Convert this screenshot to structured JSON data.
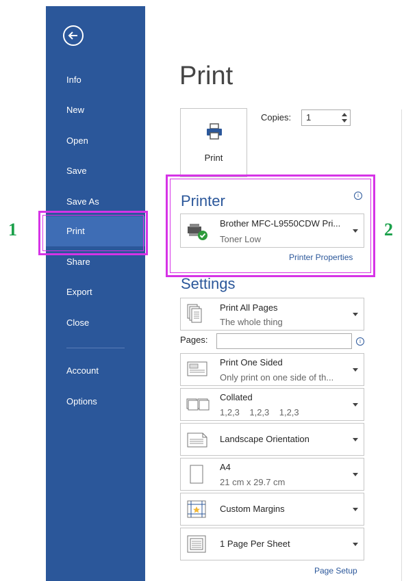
{
  "sidebar": {
    "items": [
      {
        "label": "Info"
      },
      {
        "label": "New"
      },
      {
        "label": "Open"
      },
      {
        "label": "Save"
      },
      {
        "label": "Save As"
      },
      {
        "label": "Print"
      },
      {
        "label": "Share"
      },
      {
        "label": "Export"
      },
      {
        "label": "Close"
      },
      {
        "label": "Account"
      },
      {
        "label": "Options"
      }
    ],
    "active": "Print"
  },
  "main": {
    "title": "Print",
    "print_button_label": "Print",
    "copies_label": "Copies:",
    "copies_value": "1",
    "printer": {
      "section_title": "Printer",
      "name": "Brother MFC-L9550CDW Pri...",
      "status": "Toner Low",
      "properties_link": "Printer Properties"
    },
    "settings": {
      "section_title": "Settings",
      "print_range": {
        "title": "Print All Pages",
        "subtitle": "The whole thing"
      },
      "pages_label": "Pages:",
      "pages_value": "",
      "sides": {
        "title": "Print One Sided",
        "subtitle": "Only print on one side of th..."
      },
      "collation": {
        "title": "Collated",
        "subtitle": "1,2,3    1,2,3    1,2,3"
      },
      "orientation": {
        "title": "Landscape Orientation"
      },
      "paper": {
        "title": "A4",
        "subtitle": "21 cm x 29.7 cm"
      },
      "margins": {
        "title": "Custom Margins"
      },
      "per_sheet": {
        "title": "1 Page Per Sheet"
      },
      "page_setup_link": "Page Setup"
    }
  },
  "callouts": {
    "one": "1",
    "two": "2"
  },
  "colors": {
    "sidebar": "#2b579a",
    "active": "#3e6db5",
    "highlight": "#d633e6",
    "callout": "#1aa04a"
  }
}
